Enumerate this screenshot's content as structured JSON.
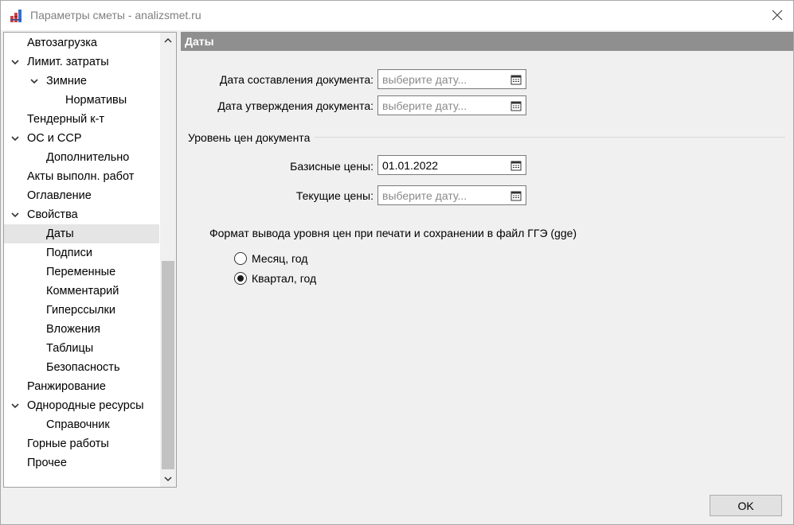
{
  "window": {
    "title": "Параметры сметы - analizsmet.ru"
  },
  "tree": {
    "items": [
      {
        "label": "Автозагрузка",
        "level": 0,
        "expanded": false,
        "has_children": false
      },
      {
        "label": "Лимит. затраты",
        "level": 0,
        "expanded": true,
        "has_children": true
      },
      {
        "label": "Зимние",
        "level": 1,
        "expanded": true,
        "has_children": true
      },
      {
        "label": "Нормативы",
        "level": 2,
        "expanded": false,
        "has_children": false
      },
      {
        "label": "Тендерный к-т",
        "level": 0,
        "expanded": false,
        "has_children": false
      },
      {
        "label": "ОС и ССР",
        "level": 0,
        "expanded": true,
        "has_children": true
      },
      {
        "label": "Дополнительно",
        "level": 1,
        "expanded": false,
        "has_children": false
      },
      {
        "label": "Акты выполн. работ",
        "level": 0,
        "expanded": false,
        "has_children": false
      },
      {
        "label": "Оглавление",
        "level": 0,
        "expanded": false,
        "has_children": false
      },
      {
        "label": "Свойства",
        "level": 0,
        "expanded": true,
        "has_children": true
      },
      {
        "label": "Даты",
        "level": 1,
        "expanded": false,
        "has_children": false,
        "selected": true
      },
      {
        "label": "Подписи",
        "level": 1,
        "expanded": false,
        "has_children": false
      },
      {
        "label": "Переменные",
        "level": 1,
        "expanded": false,
        "has_children": false
      },
      {
        "label": "Комментарий",
        "level": 1,
        "expanded": false,
        "has_children": false
      },
      {
        "label": "Гиперссылки",
        "level": 1,
        "expanded": false,
        "has_children": false
      },
      {
        "label": "Вложения",
        "level": 1,
        "expanded": false,
        "has_children": false
      },
      {
        "label": "Таблицы",
        "level": 1,
        "expanded": false,
        "has_children": false
      },
      {
        "label": "Безопасность",
        "level": 1,
        "expanded": false,
        "has_children": false
      },
      {
        "label": "Ранжирование",
        "level": 0,
        "expanded": false,
        "has_children": false
      },
      {
        "label": "Однородные ресурсы",
        "level": 0,
        "expanded": true,
        "has_children": true
      },
      {
        "label": "Справочник",
        "level": 1,
        "expanded": false,
        "has_children": false
      },
      {
        "label": "Горные работы",
        "level": 0,
        "expanded": false,
        "has_children": false
      },
      {
        "label": "Прочее",
        "level": 0,
        "expanded": false,
        "has_children": false
      }
    ]
  },
  "panel": {
    "header": "Даты",
    "doc_date_label": "Дата составления документа:",
    "doc_date_value": "",
    "doc_date_placeholder": "выберите дату...",
    "approve_date_label": "Дата утверждения документа:",
    "approve_date_value": "",
    "approve_date_placeholder": "выберите дату...",
    "price_level_title": "Уровень цен документа",
    "base_prices_label": "Базисные цены:",
    "base_prices_value": "01.01.2022",
    "base_prices_placeholder": "",
    "current_prices_label": "Текущие цены:",
    "current_prices_value": "",
    "current_prices_placeholder": "выберите дату...",
    "format_label": "Формат вывода уровня цен при печати и сохранении в файл ГГЭ (gge)",
    "format_options": [
      {
        "label": "Месяц, год",
        "checked": false
      },
      {
        "label": "Квартал, год",
        "checked": true
      }
    ]
  },
  "footer": {
    "ok_label": "OK"
  },
  "colors": {
    "header_bg": "#8f8f8f",
    "selected_bg": "#e5e5e5",
    "thumb": "#c2c2c2"
  }
}
